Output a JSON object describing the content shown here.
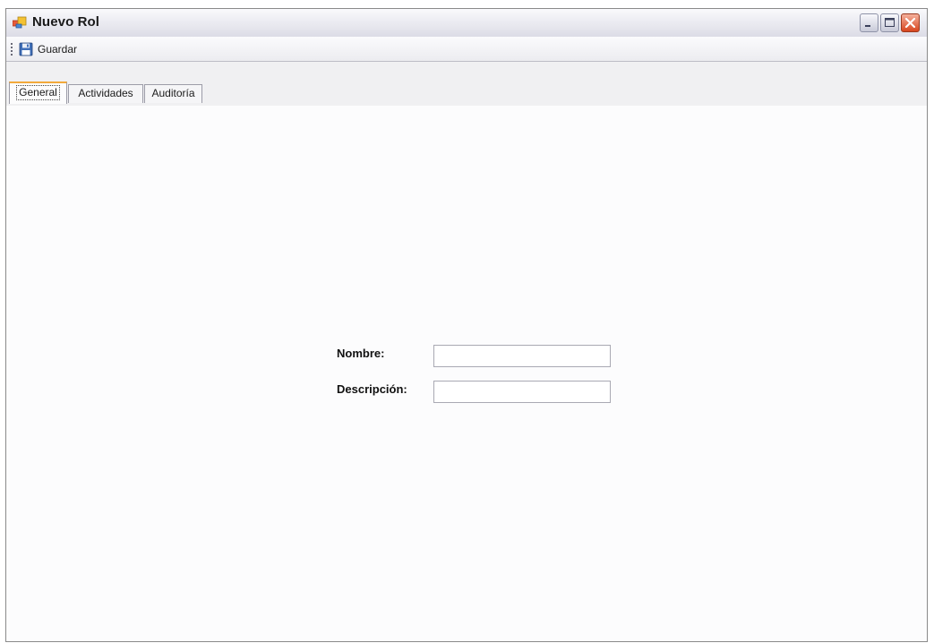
{
  "window": {
    "title": "Nuevo Rol"
  },
  "icons": {
    "app": "app-icon",
    "save": "floppy-disk-icon",
    "minimize": "minimize-icon",
    "maximize": "maximize-icon",
    "close": "close-icon"
  },
  "toolbar": {
    "save_label": "Guardar"
  },
  "tabs": [
    {
      "label": "General",
      "selected": true
    },
    {
      "label": "Actividades",
      "selected": false
    },
    {
      "label": "Auditoría",
      "selected": false
    }
  ],
  "form": {
    "nombre": {
      "label": "Nombre:",
      "value": ""
    },
    "descripcion": {
      "label": "Descripción:",
      "value": ""
    }
  },
  "colors": {
    "selected_tab_accent": "#f2a93b",
    "close_button": "#d8461e"
  }
}
